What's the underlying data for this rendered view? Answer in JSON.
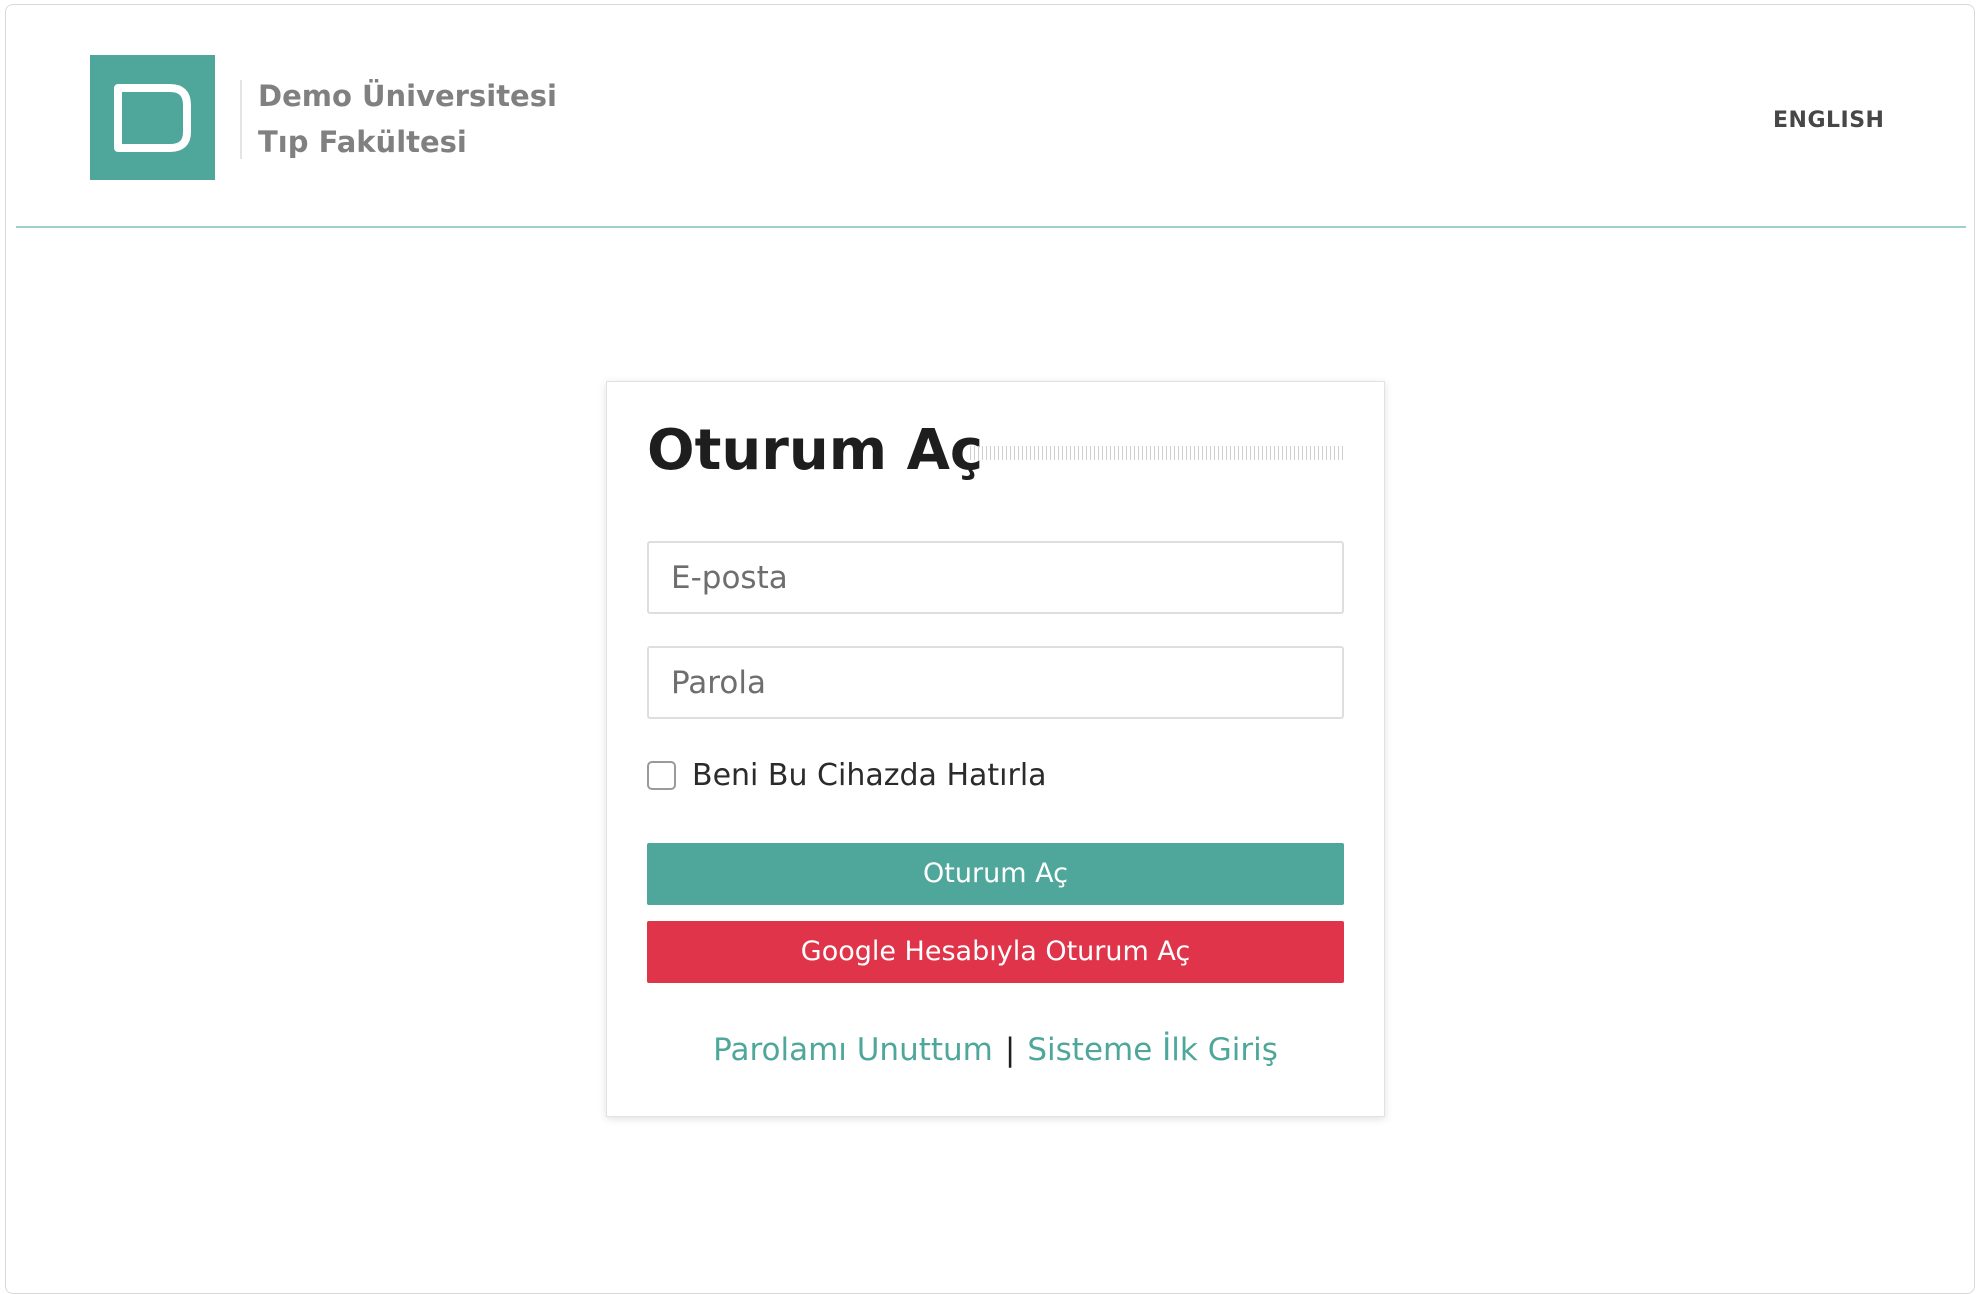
{
  "header": {
    "brand": {
      "logo_letter": "D",
      "line1": "Demo Üniversitesi",
      "line2": "Tıp Fakültesi"
    },
    "language_link": "ENGLISH"
  },
  "login_card": {
    "title": "Oturum Aç",
    "email": {
      "placeholder": "E-posta",
      "value": ""
    },
    "password": {
      "placeholder": "Parola",
      "value": ""
    },
    "remember_me": {
      "label": "Beni Bu Cihazda Hatırla",
      "checked": false
    },
    "signin_button": "Oturum Aç",
    "google_button": "Google Hesabıyla Oturum Aç",
    "links": {
      "forgot_password": "Parolamı Unuttum",
      "separator": "|",
      "first_login": "Sisteme İlk Giriş"
    }
  },
  "colors": {
    "brand_teal": "#4ea79a",
    "google_red": "#e0344a",
    "header_rule": "#9fcfcb"
  }
}
